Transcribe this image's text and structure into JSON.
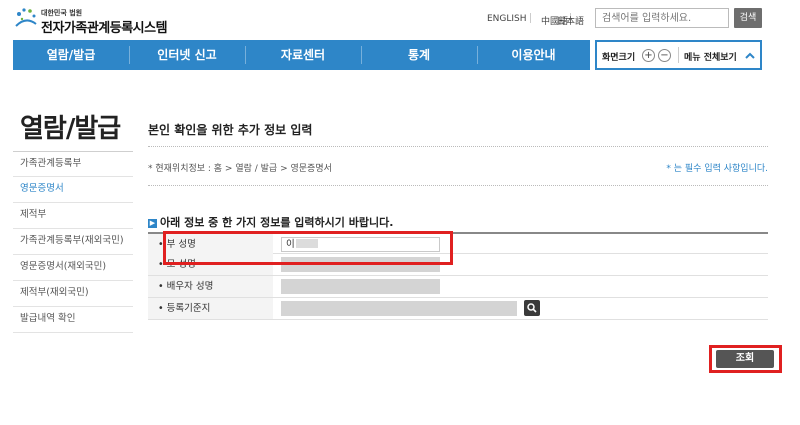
{
  "header": {
    "logo_small": "대한민국 법원",
    "logo_title": "전자가족관계등록시스템",
    "languages": [
      "ENGLISH",
      "中國語",
      "日本語"
    ],
    "search_placeholder": "검색어를 입력하세요.",
    "search_button": "검색"
  },
  "nav": {
    "items": [
      "열람/발급",
      "인터넷 신고",
      "자료센터",
      "통계",
      "이용안내"
    ]
  },
  "utility": {
    "font_size_label": "화면크기",
    "zoom_in": "+",
    "zoom_out": "−",
    "menu_all_label": "메뉴 전체보기"
  },
  "sidebar": {
    "title": "열람/발급",
    "items": [
      {
        "label": "가족관계등록부",
        "active": false
      },
      {
        "label": "영문증명서",
        "active": true
      },
      {
        "label": "제적부",
        "active": false
      },
      {
        "label": "가족관계등록부(재외국민)",
        "active": false
      },
      {
        "label": "영문증명서(재외국민)",
        "active": false
      },
      {
        "label": "제적부(재외국민)",
        "active": false
      },
      {
        "label": "발급내역 확인",
        "active": false
      }
    ]
  },
  "main": {
    "title": "본인 확인을 위한 추가 정보 입력",
    "location": "* 현재위치정보 : 홈 > 열람 / 발급 > 영문증명서",
    "required_note": "* 는 필수 입력 사항입니다.",
    "notice": "아래 정보 중 한 가지 정보를 입력하시기 바랍니다.",
    "form": {
      "father_label": "• 부 성명",
      "father_value": "이",
      "mother_label": "• 모 성명",
      "spouse_label": "• 배우자 성명",
      "registry_label": "• 등록기준지"
    },
    "lookup_button": "조회"
  },
  "colors": {
    "accent": "#2e86c8",
    "highlight": "#e02020"
  }
}
